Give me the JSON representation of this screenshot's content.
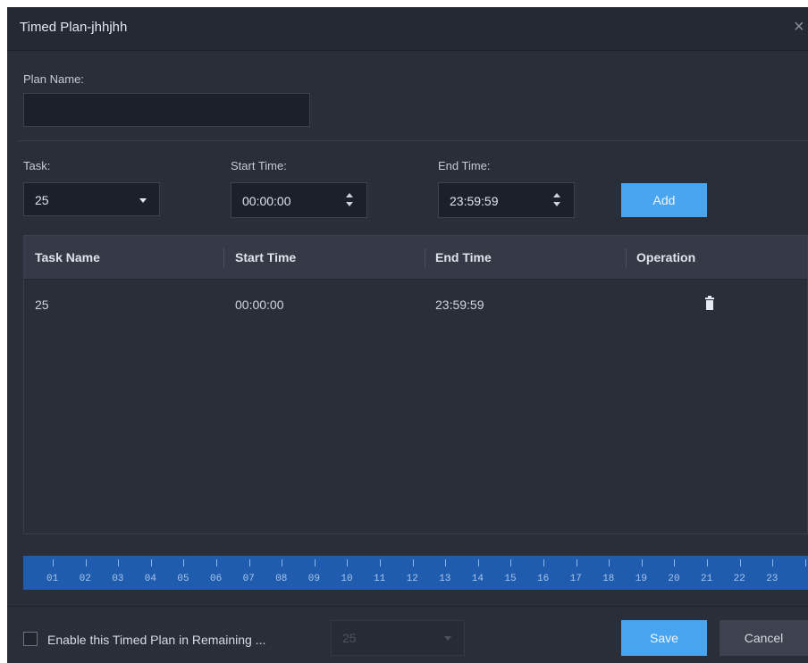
{
  "dialog": {
    "title": "Timed Plan-jhhjhh",
    "close_symbol": "×"
  },
  "plan_name": {
    "label": "Plan Name:",
    "value": ""
  },
  "task": {
    "label": "Task:",
    "selected": "25"
  },
  "start_time": {
    "label": "Start Time:",
    "value": "00:00:00"
  },
  "end_time": {
    "label": "End Time:",
    "value": "23:59:59"
  },
  "add_button": "Add",
  "table": {
    "headers": [
      "Task Name",
      "Start Time",
      "End Time",
      "Operation"
    ],
    "rows": [
      {
        "task_name": "25",
        "start_time": "00:00:00",
        "end_time": "23:59:59",
        "operation_icon": "trash-icon"
      }
    ]
  },
  "timeline": {
    "hours": [
      "01",
      "02",
      "03",
      "04",
      "05",
      "06",
      "07",
      "08",
      "09",
      "10",
      "11",
      "12",
      "13",
      "14",
      "15",
      "16",
      "17",
      "18",
      "19",
      "20",
      "21",
      "22",
      "23"
    ]
  },
  "footer": {
    "checkbox_label": "Enable this Timed Plan in Remaining ...",
    "checkbox_checked": false,
    "remaining_select": "25",
    "save_label": "Save",
    "cancel_label": "Cancel"
  },
  "colors": {
    "background": "#2a2e39",
    "primary_button": "#4aa5f0",
    "timeline": "#1f5cad"
  }
}
